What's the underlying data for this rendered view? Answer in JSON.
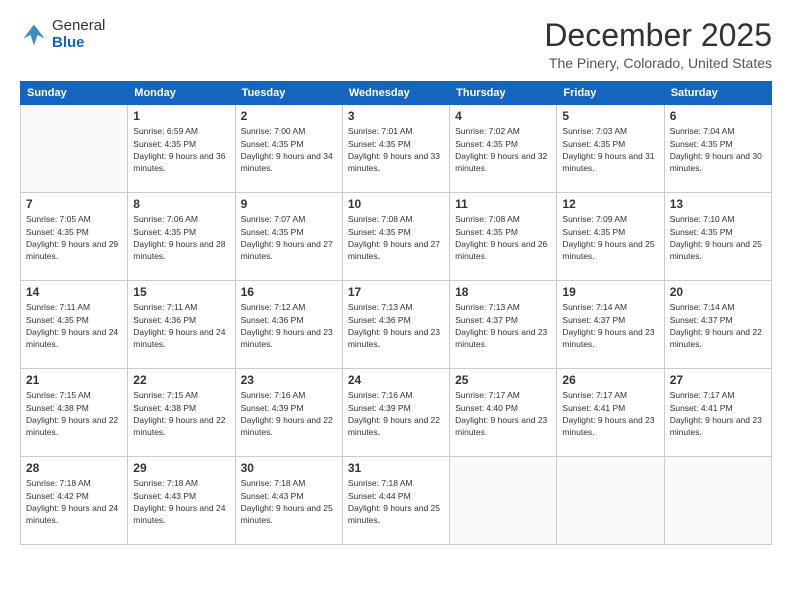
{
  "header": {
    "logo_general": "General",
    "logo_blue": "Blue",
    "month": "December 2025",
    "location": "The Pinery, Colorado, United States"
  },
  "days_of_week": [
    "Sunday",
    "Monday",
    "Tuesday",
    "Wednesday",
    "Thursday",
    "Friday",
    "Saturday"
  ],
  "weeks": [
    [
      {
        "day": "",
        "sunrise": "",
        "sunset": "",
        "daylight": "",
        "empty": true
      },
      {
        "day": "1",
        "sunrise": "Sunrise: 6:59 AM",
        "sunset": "Sunset: 4:35 PM",
        "daylight": "Daylight: 9 hours and 36 minutes."
      },
      {
        "day": "2",
        "sunrise": "Sunrise: 7:00 AM",
        "sunset": "Sunset: 4:35 PM",
        "daylight": "Daylight: 9 hours and 34 minutes."
      },
      {
        "day": "3",
        "sunrise": "Sunrise: 7:01 AM",
        "sunset": "Sunset: 4:35 PM",
        "daylight": "Daylight: 9 hours and 33 minutes."
      },
      {
        "day": "4",
        "sunrise": "Sunrise: 7:02 AM",
        "sunset": "Sunset: 4:35 PM",
        "daylight": "Daylight: 9 hours and 32 minutes."
      },
      {
        "day": "5",
        "sunrise": "Sunrise: 7:03 AM",
        "sunset": "Sunset: 4:35 PM",
        "daylight": "Daylight: 9 hours and 31 minutes."
      },
      {
        "day": "6",
        "sunrise": "Sunrise: 7:04 AM",
        "sunset": "Sunset: 4:35 PM",
        "daylight": "Daylight: 9 hours and 30 minutes."
      }
    ],
    [
      {
        "day": "7",
        "sunrise": "Sunrise: 7:05 AM",
        "sunset": "Sunset: 4:35 PM",
        "daylight": "Daylight: 9 hours and 29 minutes."
      },
      {
        "day": "8",
        "sunrise": "Sunrise: 7:06 AM",
        "sunset": "Sunset: 4:35 PM",
        "daylight": "Daylight: 9 hours and 28 minutes."
      },
      {
        "day": "9",
        "sunrise": "Sunrise: 7:07 AM",
        "sunset": "Sunset: 4:35 PM",
        "daylight": "Daylight: 9 hours and 27 minutes."
      },
      {
        "day": "10",
        "sunrise": "Sunrise: 7:08 AM",
        "sunset": "Sunset: 4:35 PM",
        "daylight": "Daylight: 9 hours and 27 minutes."
      },
      {
        "day": "11",
        "sunrise": "Sunrise: 7:08 AM",
        "sunset": "Sunset: 4:35 PM",
        "daylight": "Daylight: 9 hours and 26 minutes."
      },
      {
        "day": "12",
        "sunrise": "Sunrise: 7:09 AM",
        "sunset": "Sunset: 4:35 PM",
        "daylight": "Daylight: 9 hours and 25 minutes."
      },
      {
        "day": "13",
        "sunrise": "Sunrise: 7:10 AM",
        "sunset": "Sunset: 4:35 PM",
        "daylight": "Daylight: 9 hours and 25 minutes."
      }
    ],
    [
      {
        "day": "14",
        "sunrise": "Sunrise: 7:11 AM",
        "sunset": "Sunset: 4:35 PM",
        "daylight": "Daylight: 9 hours and 24 minutes."
      },
      {
        "day": "15",
        "sunrise": "Sunrise: 7:11 AM",
        "sunset": "Sunset: 4:36 PM",
        "daylight": "Daylight: 9 hours and 24 minutes."
      },
      {
        "day": "16",
        "sunrise": "Sunrise: 7:12 AM",
        "sunset": "Sunset: 4:36 PM",
        "daylight": "Daylight: 9 hours and 23 minutes."
      },
      {
        "day": "17",
        "sunrise": "Sunrise: 7:13 AM",
        "sunset": "Sunset: 4:36 PM",
        "daylight": "Daylight: 9 hours and 23 minutes."
      },
      {
        "day": "18",
        "sunrise": "Sunrise: 7:13 AM",
        "sunset": "Sunset: 4:37 PM",
        "daylight": "Daylight: 9 hours and 23 minutes."
      },
      {
        "day": "19",
        "sunrise": "Sunrise: 7:14 AM",
        "sunset": "Sunset: 4:37 PM",
        "daylight": "Daylight: 9 hours and 23 minutes."
      },
      {
        "day": "20",
        "sunrise": "Sunrise: 7:14 AM",
        "sunset": "Sunset: 4:37 PM",
        "daylight": "Daylight: 9 hours and 22 minutes."
      }
    ],
    [
      {
        "day": "21",
        "sunrise": "Sunrise: 7:15 AM",
        "sunset": "Sunset: 4:38 PM",
        "daylight": "Daylight: 9 hours and 22 minutes."
      },
      {
        "day": "22",
        "sunrise": "Sunrise: 7:15 AM",
        "sunset": "Sunset: 4:38 PM",
        "daylight": "Daylight: 9 hours and 22 minutes."
      },
      {
        "day": "23",
        "sunrise": "Sunrise: 7:16 AM",
        "sunset": "Sunset: 4:39 PM",
        "daylight": "Daylight: 9 hours and 22 minutes."
      },
      {
        "day": "24",
        "sunrise": "Sunrise: 7:16 AM",
        "sunset": "Sunset: 4:39 PM",
        "daylight": "Daylight: 9 hours and 22 minutes."
      },
      {
        "day": "25",
        "sunrise": "Sunrise: 7:17 AM",
        "sunset": "Sunset: 4:40 PM",
        "daylight": "Daylight: 9 hours and 23 minutes."
      },
      {
        "day": "26",
        "sunrise": "Sunrise: 7:17 AM",
        "sunset": "Sunset: 4:41 PM",
        "daylight": "Daylight: 9 hours and 23 minutes."
      },
      {
        "day": "27",
        "sunrise": "Sunrise: 7:17 AM",
        "sunset": "Sunset: 4:41 PM",
        "daylight": "Daylight: 9 hours and 23 minutes."
      }
    ],
    [
      {
        "day": "28",
        "sunrise": "Sunrise: 7:18 AM",
        "sunset": "Sunset: 4:42 PM",
        "daylight": "Daylight: 9 hours and 24 minutes."
      },
      {
        "day": "29",
        "sunrise": "Sunrise: 7:18 AM",
        "sunset": "Sunset: 4:43 PM",
        "daylight": "Daylight: 9 hours and 24 minutes."
      },
      {
        "day": "30",
        "sunrise": "Sunrise: 7:18 AM",
        "sunset": "Sunset: 4:43 PM",
        "daylight": "Daylight: 9 hours and 25 minutes."
      },
      {
        "day": "31",
        "sunrise": "Sunrise: 7:18 AM",
        "sunset": "Sunset: 4:44 PM",
        "daylight": "Daylight: 9 hours and 25 minutes."
      },
      {
        "day": "",
        "sunrise": "",
        "sunset": "",
        "daylight": "",
        "empty": true
      },
      {
        "day": "",
        "sunrise": "",
        "sunset": "",
        "daylight": "",
        "empty": true
      },
      {
        "day": "",
        "sunrise": "",
        "sunset": "",
        "daylight": "",
        "empty": true
      }
    ]
  ]
}
